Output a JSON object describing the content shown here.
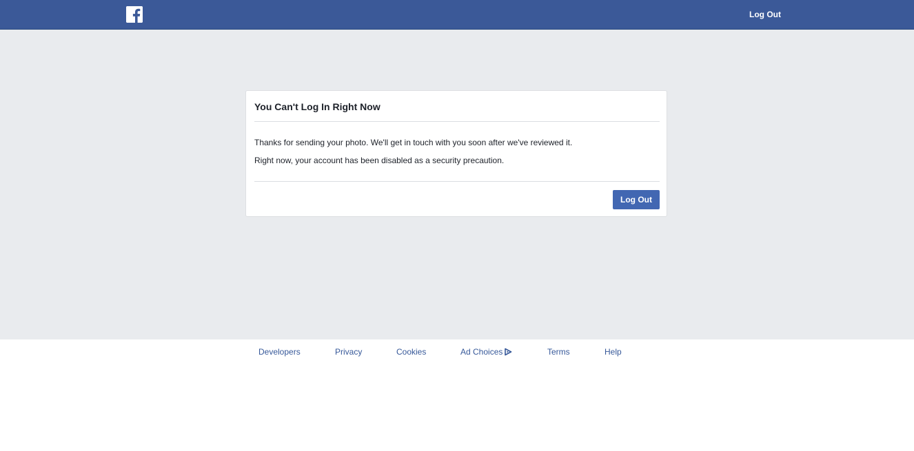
{
  "header": {
    "logo_icon": "facebook-logo-icon",
    "logout_label": "Log Out",
    "brand_color": "#3b5998"
  },
  "dialog": {
    "title": "You Can't Log In Right Now",
    "message_1": "Thanks for sending your photo. We'll get in touch with you soon after we've reviewed it.",
    "message_2": "Right now, your account has been disabled as a security precaution.",
    "logout_button": "Log Out",
    "button_color": "#4267b2"
  },
  "footer": {
    "links": [
      {
        "label": "Developers"
      },
      {
        "label": "Privacy"
      },
      {
        "label": "Cookies"
      },
      {
        "label": "Ad Choices",
        "icon": "adchoices-icon"
      },
      {
        "label": "Terms"
      },
      {
        "label": "Help"
      }
    ],
    "link_color": "#365899"
  }
}
